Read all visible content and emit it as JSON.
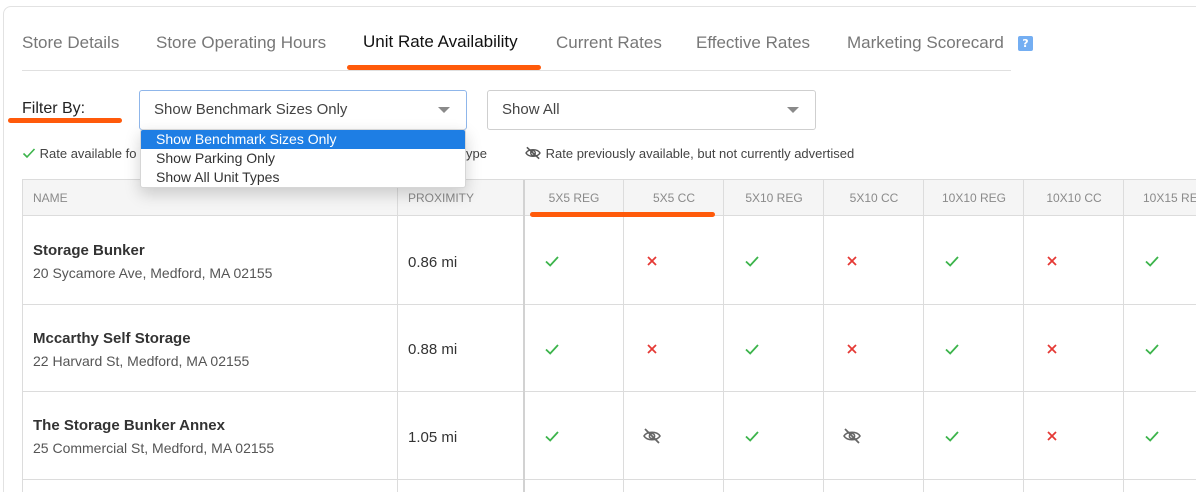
{
  "tabs": [
    {
      "label": "Store Details",
      "active": false
    },
    {
      "label": "Store Operating Hours",
      "active": false
    },
    {
      "label": "Unit Rate Availability",
      "active": true
    },
    {
      "label": "Current Rates",
      "active": false
    },
    {
      "label": "Effective Rates",
      "active": false
    },
    {
      "label": "Marketing Scorecard",
      "active": false
    }
  ],
  "help_icon": {
    "glyph": "?",
    "icon": "question-icon",
    "color": "#74aef2"
  },
  "filter": {
    "label": "Filter By:",
    "primary_select": {
      "value": "Show Benchmark Sizes Only",
      "options": [
        "Show Benchmark Sizes Only",
        "Show Parking Only",
        "Show All Unit Types"
      ],
      "selected_index": 0
    },
    "secondary_select": {
      "value": "Show All"
    }
  },
  "legend": {
    "available_prefix": "Rate available fo",
    "available_suffix": "ype",
    "previously": "Rate previously available, but not currently advertised"
  },
  "table": {
    "headers": [
      "NAME",
      "PROXIMITY",
      "5X5 REG",
      "5X5 CC",
      "5X10 REG",
      "5X10 CC",
      "10X10 REG",
      "10X10 CC",
      "10X15 RE"
    ],
    "rows": [
      {
        "name": "Storage Bunker",
        "address": "20 Sycamore Ave, Medford, MA 02155",
        "proximity": "0.86 mi",
        "cells": [
          "check",
          "cross",
          "check",
          "cross",
          "check",
          "cross",
          "check"
        ]
      },
      {
        "name": "Mccarthy Self Storage",
        "address": "22 Harvard St, Medford, MA 02155",
        "proximity": "0.88 mi",
        "cells": [
          "check",
          "cross",
          "check",
          "cross",
          "check",
          "cross",
          "check"
        ]
      },
      {
        "name": "The Storage Bunker Annex",
        "address": "25 Commercial St, Medford, MA 02155",
        "proximity": "1.05 mi",
        "cells": [
          "check",
          "eye-off",
          "check",
          "eye-off",
          "check",
          "cross",
          "check"
        ]
      }
    ]
  },
  "colors": {
    "accent": "#ff5a0a",
    "check": "#3cb44b",
    "cross": "#e53935",
    "eye_off": "#666666",
    "selected_option": "#1e7ee4"
  }
}
